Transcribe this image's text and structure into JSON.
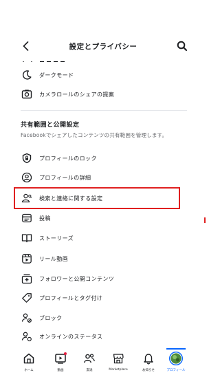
{
  "header": {
    "title": "設定とプライバシー"
  },
  "top_rows": [
    {
      "icon": "moon-icon",
      "label": "ダークモード"
    },
    {
      "icon": "camera-roll-icon",
      "label": "カメラロールのシェアの提案"
    }
  ],
  "section": {
    "title": "共有範囲と公開設定",
    "description": "Facebookでシェアしたコンテンツの共有範囲を管理します。",
    "items": [
      {
        "icon": "profile-lock-icon",
        "label": "プロフィールのロック"
      },
      {
        "icon": "profile-details-icon",
        "label": "プロフィールの詳細"
      },
      {
        "icon": "find-and-contact-icon",
        "label": "検索と連絡に関する設定"
      },
      {
        "icon": "posts-icon",
        "label": "投稿"
      },
      {
        "icon": "stories-icon",
        "label": "ストーリーズ"
      },
      {
        "icon": "reels-icon",
        "label": "リール動画"
      },
      {
        "icon": "followers-icon",
        "label": "フォロワーと公開コンテンツ"
      },
      {
        "icon": "tag-icon",
        "label": "プロフィールとタグ付け"
      },
      {
        "icon": "block-icon",
        "label": "ブロック"
      },
      {
        "icon": "online-status-icon",
        "label": "オンラインのステータス"
      }
    ]
  },
  "tabs": [
    {
      "icon": "home-icon",
      "label": "ホーム"
    },
    {
      "icon": "video-icon",
      "label": "動画"
    },
    {
      "icon": "friends-icon",
      "label": "友達"
    },
    {
      "icon": "marketplace-icon",
      "label": "Marketplace"
    },
    {
      "icon": "bell-icon",
      "label": "お知らせ"
    },
    {
      "icon": "profile-avatar-icon",
      "label": "プロフィール"
    }
  ],
  "colors": {
    "accent": "#0866ff",
    "highlight_border": "#e02020",
    "text": "#1c1e21",
    "secondary_text": "#65676b"
  }
}
